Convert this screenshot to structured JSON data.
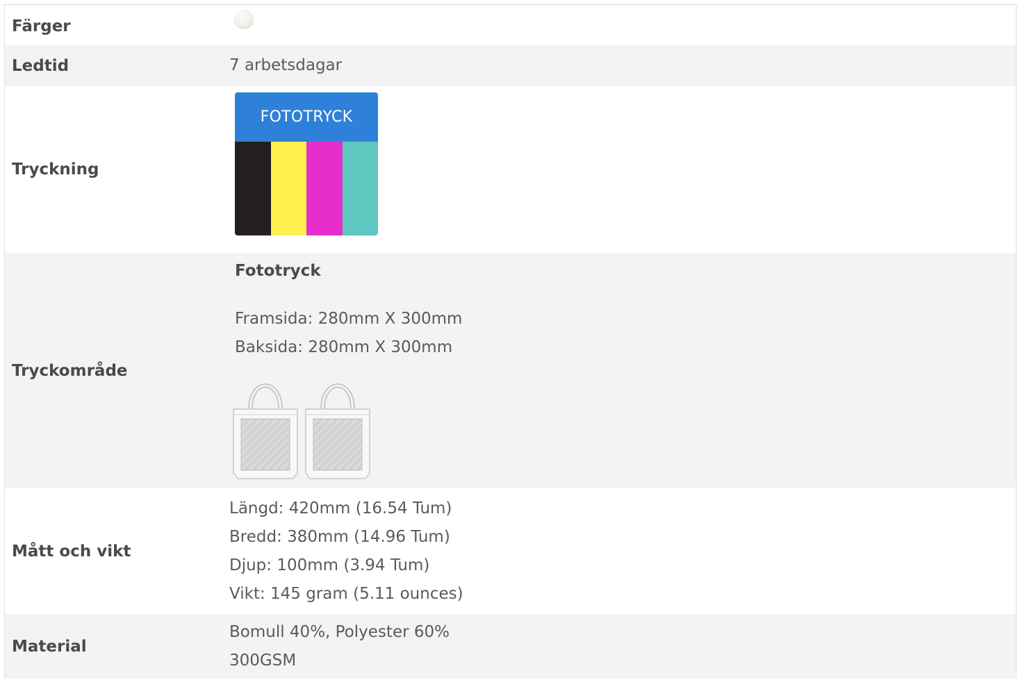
{
  "spec_rows": {
    "colors": {
      "label": "Färger",
      "swatch_color": "#f3f2ec"
    },
    "leadtime": {
      "label": "Ledtid",
      "value": "7 arbetsdagar"
    },
    "printing": {
      "label": "Tryckning",
      "card_title": "FOTOTRYCK",
      "card_header_color": "#2f80d9",
      "bar_colors": [
        "#231f20",
        "#fdf04f",
        "#e72ecd",
        "#5ec7bf"
      ]
    },
    "print_area": {
      "label": "Tryckområde",
      "method": "Fototryck",
      "front": "Framsida: 280mm X 300mm",
      "back": "Baksida: 280mm X 300mm",
      "illustrations": [
        "tote-bag-front-icon",
        "tote-bag-back-icon"
      ]
    },
    "dimensions": {
      "label": "Mått och vikt",
      "length": "Längd: 420mm (16.54 Tum)",
      "width": "Bredd: 380mm (14.96 Tum)",
      "depth": "Djup: 100mm (3.94 Tum)",
      "weight": "Vikt: 145 gram (5.11 ounces)"
    },
    "material": {
      "label": "Material",
      "composition": "Bomull 40%, Polyester 60%",
      "weight": "300GSM"
    }
  }
}
